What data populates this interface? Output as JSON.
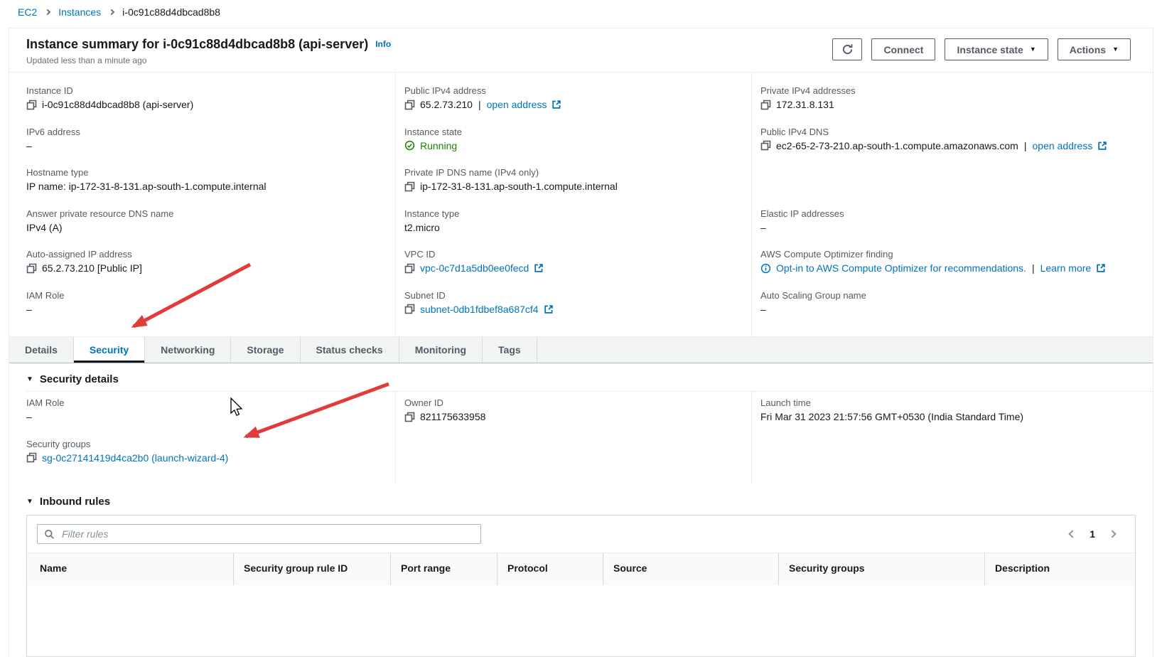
{
  "breadcrumb": {
    "items": [
      "EC2",
      "Instances",
      "i-0c91c88d4dbcad8b8"
    ]
  },
  "header": {
    "title": "Instance summary for i-0c91c88d4dbcad8b8 (api-server)",
    "info": "Info",
    "updated": "Updated less than a minute ago",
    "connect": "Connect",
    "instance_state": "Instance state",
    "actions": "Actions"
  },
  "tabs": {
    "active": "Security",
    "items": [
      "Details",
      "Security",
      "Networking",
      "Storage",
      "Status checks",
      "Monitoring",
      "Tags"
    ]
  },
  "summary": {
    "col1": [
      {
        "label": "Instance ID",
        "segs": [
          {
            "k": "copy"
          },
          {
            "k": "t",
            "v": "i-0c91c88d4dbcad8b8 (api-server)"
          }
        ]
      },
      {
        "label": "IPv6 address",
        "segs": [
          {
            "k": "t",
            "v": "–"
          }
        ]
      },
      {
        "label": "Hostname type",
        "segs": [
          {
            "k": "t",
            "v": "IP name: ip-172-31-8-131.ap-south-1.compute.internal"
          }
        ]
      },
      {
        "label": "Answer private resource DNS name",
        "segs": [
          {
            "k": "t",
            "v": "IPv4 (A)"
          }
        ]
      },
      {
        "label": "Auto-assigned IP address",
        "segs": [
          {
            "k": "copy"
          },
          {
            "k": "t",
            "v": "65.2.73.210 [Public IP]"
          }
        ]
      },
      {
        "label": "IAM Role",
        "segs": [
          {
            "k": "t",
            "v": "–"
          }
        ]
      }
    ],
    "col2": [
      {
        "label": "Public IPv4 address",
        "segs": [
          {
            "k": "copy"
          },
          {
            "k": "t",
            "v": "65.2.73.210"
          },
          {
            "k": "sep"
          },
          {
            "k": "a",
            "v": "open address"
          },
          {
            "k": "ext"
          }
        ]
      },
      {
        "label": "Instance state",
        "segs": [
          {
            "k": "check"
          },
          {
            "k": "run",
            "v": "Running"
          }
        ]
      },
      {
        "label": "Private IP DNS name (IPv4 only)",
        "segs": [
          {
            "k": "copy"
          },
          {
            "k": "t",
            "v": "ip-172-31-8-131.ap-south-1.compute.internal"
          }
        ]
      },
      {
        "label": "Instance type",
        "segs": [
          {
            "k": "t",
            "v": "t2.micro"
          }
        ]
      },
      {
        "label": "VPC ID",
        "segs": [
          {
            "k": "copy"
          },
          {
            "k": "a",
            "v": "vpc-0c7d1a5db0ee0fecd"
          },
          {
            "k": "ext"
          }
        ]
      },
      {
        "label": "Subnet ID",
        "segs": [
          {
            "k": "copy"
          },
          {
            "k": "a",
            "v": "subnet-0db1fdbef8a687cf4"
          },
          {
            "k": "ext"
          }
        ]
      }
    ],
    "col3": [
      {
        "label": "Private IPv4 addresses",
        "segs": [
          {
            "k": "copy"
          },
          {
            "k": "t",
            "v": "172.31.8.131"
          }
        ]
      },
      {
        "label": "Public IPv4 DNS",
        "segs": [
          {
            "k": "copy"
          },
          {
            "k": "t",
            "v": "ec2-65-2-73-210.ap-south-1.compute.amazonaws.com"
          },
          {
            "k": "sep"
          },
          {
            "k": "a",
            "v": "open address"
          },
          {
            "k": "ext"
          }
        ]
      },
      {
        "spacer": true
      },
      {
        "label": "Elastic IP addresses",
        "segs": [
          {
            "k": "t",
            "v": "–"
          }
        ]
      },
      {
        "label": "AWS Compute Optimizer finding",
        "segs": [
          {
            "k": "info"
          },
          {
            "k": "a",
            "v": "Opt-in to AWS Compute Optimizer for recommendations."
          },
          {
            "k": "sep"
          },
          {
            "k": "a",
            "v": "Learn more"
          },
          {
            "k": "ext"
          }
        ]
      },
      {
        "label": "Auto Scaling Group name",
        "segs": [
          {
            "k": "t",
            "v": "–"
          }
        ]
      }
    ]
  },
  "security_details": {
    "title": "Security details",
    "col1": [
      {
        "label": "IAM Role",
        "segs": [
          {
            "k": "t",
            "v": "–"
          }
        ]
      },
      {
        "label": "Security groups",
        "segs": [
          {
            "k": "copy"
          },
          {
            "k": "a",
            "v": "sg-0c27141419d4ca2b0 (launch-wizard-4)"
          }
        ]
      }
    ],
    "col2": [
      {
        "label": "Owner ID",
        "segs": [
          {
            "k": "copy"
          },
          {
            "k": "t",
            "v": "821175633958"
          }
        ]
      }
    ],
    "col3": [
      {
        "label": "Launch time",
        "segs": [
          {
            "k": "t",
            "v": "Fri Mar 31 2023 21:57:56 GMT+0530 (India Standard Time)"
          }
        ]
      }
    ]
  },
  "inbound_rules": {
    "title": "Inbound rules",
    "filter_placeholder": "Filter rules",
    "page": "1",
    "columns": [
      "Name",
      "Security group rule ID",
      "Port range",
      "Protocol",
      "Source",
      "Security groups",
      "Description"
    ]
  },
  "colors": {
    "link": "#0073bb",
    "running": "#1d8102",
    "annotation_arrow": "#e13b3b"
  }
}
